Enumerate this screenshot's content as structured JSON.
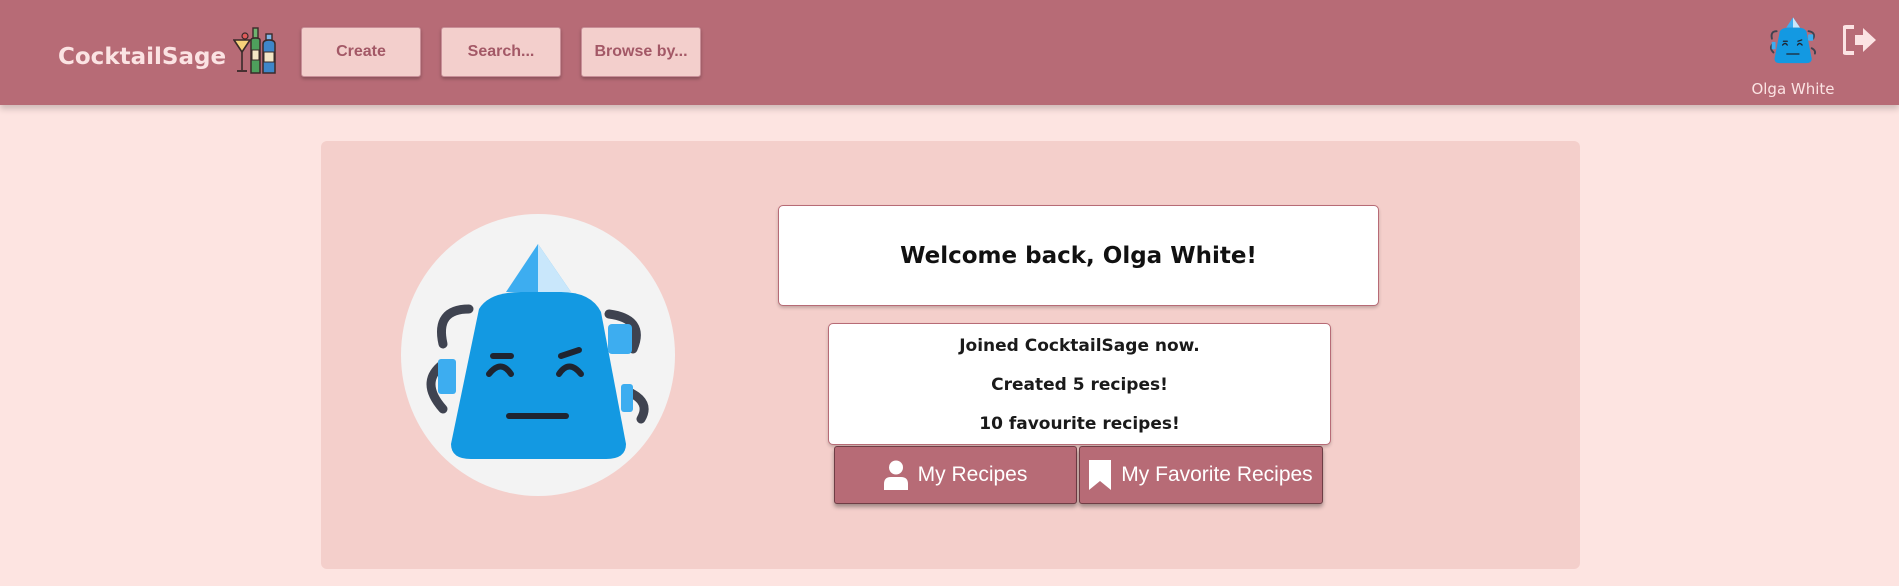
{
  "navbar": {
    "brand": "CocktailSage",
    "create_label": "Create",
    "search_label": "Search...",
    "browse_label": "Browse by...",
    "user_name": "Olga White",
    "logo_icon": "cocktail-bottles-icon",
    "logout_icon": "sign-out-icon"
  },
  "profile": {
    "welcome": "Welcome back, Olga White!",
    "stats": [
      "Joined CocktailSage now.",
      "Created 5 recipes!",
      "10 favourite recipes!"
    ],
    "my_recipes_label": "My Recipes",
    "my_favorites_label": "My Favorite Recipes"
  },
  "colors": {
    "navbar": "#b76b76",
    "page_background": "#fde4e1",
    "card_background": "#f4cfcb",
    "nav_button": "#f3cfcc",
    "avatar_blue": "#1399e2"
  }
}
